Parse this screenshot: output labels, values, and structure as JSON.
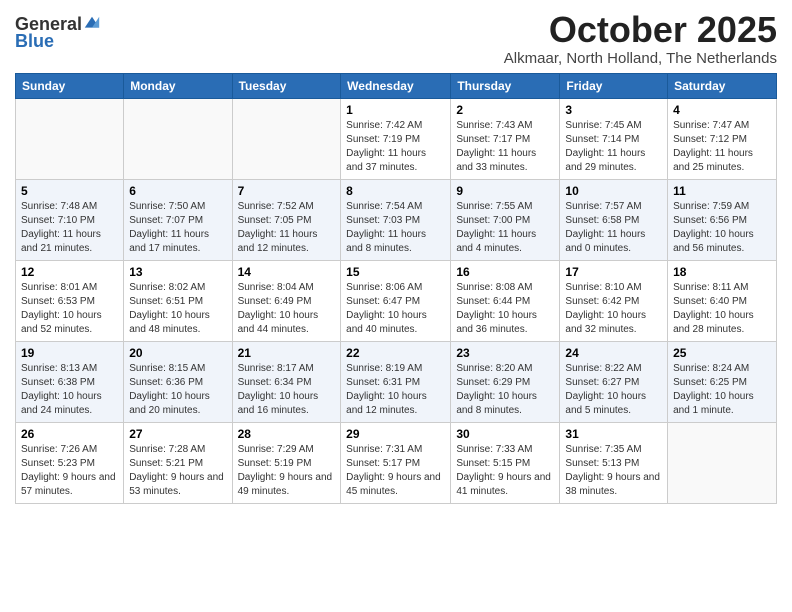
{
  "logo": {
    "general": "General",
    "blue": "Blue"
  },
  "title": "October 2025",
  "subtitle": "Alkmaar, North Holland, The Netherlands",
  "weekdays": [
    "Sunday",
    "Monday",
    "Tuesday",
    "Wednesday",
    "Thursday",
    "Friday",
    "Saturday"
  ],
  "weeks": [
    [
      {
        "day": "",
        "info": ""
      },
      {
        "day": "",
        "info": ""
      },
      {
        "day": "",
        "info": ""
      },
      {
        "day": "1",
        "info": "Sunrise: 7:42 AM\nSunset: 7:19 PM\nDaylight: 11 hours and 37 minutes."
      },
      {
        "day": "2",
        "info": "Sunrise: 7:43 AM\nSunset: 7:17 PM\nDaylight: 11 hours and 33 minutes."
      },
      {
        "day": "3",
        "info": "Sunrise: 7:45 AM\nSunset: 7:14 PM\nDaylight: 11 hours and 29 minutes."
      },
      {
        "day": "4",
        "info": "Sunrise: 7:47 AM\nSunset: 7:12 PM\nDaylight: 11 hours and 25 minutes."
      }
    ],
    [
      {
        "day": "5",
        "info": "Sunrise: 7:48 AM\nSunset: 7:10 PM\nDaylight: 11 hours and 21 minutes."
      },
      {
        "day": "6",
        "info": "Sunrise: 7:50 AM\nSunset: 7:07 PM\nDaylight: 11 hours and 17 minutes."
      },
      {
        "day": "7",
        "info": "Sunrise: 7:52 AM\nSunset: 7:05 PM\nDaylight: 11 hours and 12 minutes."
      },
      {
        "day": "8",
        "info": "Sunrise: 7:54 AM\nSunset: 7:03 PM\nDaylight: 11 hours and 8 minutes."
      },
      {
        "day": "9",
        "info": "Sunrise: 7:55 AM\nSunset: 7:00 PM\nDaylight: 11 hours and 4 minutes."
      },
      {
        "day": "10",
        "info": "Sunrise: 7:57 AM\nSunset: 6:58 PM\nDaylight: 11 hours and 0 minutes."
      },
      {
        "day": "11",
        "info": "Sunrise: 7:59 AM\nSunset: 6:56 PM\nDaylight: 10 hours and 56 minutes."
      }
    ],
    [
      {
        "day": "12",
        "info": "Sunrise: 8:01 AM\nSunset: 6:53 PM\nDaylight: 10 hours and 52 minutes."
      },
      {
        "day": "13",
        "info": "Sunrise: 8:02 AM\nSunset: 6:51 PM\nDaylight: 10 hours and 48 minutes."
      },
      {
        "day": "14",
        "info": "Sunrise: 8:04 AM\nSunset: 6:49 PM\nDaylight: 10 hours and 44 minutes."
      },
      {
        "day": "15",
        "info": "Sunrise: 8:06 AM\nSunset: 6:47 PM\nDaylight: 10 hours and 40 minutes."
      },
      {
        "day": "16",
        "info": "Sunrise: 8:08 AM\nSunset: 6:44 PM\nDaylight: 10 hours and 36 minutes."
      },
      {
        "day": "17",
        "info": "Sunrise: 8:10 AM\nSunset: 6:42 PM\nDaylight: 10 hours and 32 minutes."
      },
      {
        "day": "18",
        "info": "Sunrise: 8:11 AM\nSunset: 6:40 PM\nDaylight: 10 hours and 28 minutes."
      }
    ],
    [
      {
        "day": "19",
        "info": "Sunrise: 8:13 AM\nSunset: 6:38 PM\nDaylight: 10 hours and 24 minutes."
      },
      {
        "day": "20",
        "info": "Sunrise: 8:15 AM\nSunset: 6:36 PM\nDaylight: 10 hours and 20 minutes."
      },
      {
        "day": "21",
        "info": "Sunrise: 8:17 AM\nSunset: 6:34 PM\nDaylight: 10 hours and 16 minutes."
      },
      {
        "day": "22",
        "info": "Sunrise: 8:19 AM\nSunset: 6:31 PM\nDaylight: 10 hours and 12 minutes."
      },
      {
        "day": "23",
        "info": "Sunrise: 8:20 AM\nSunset: 6:29 PM\nDaylight: 10 hours and 8 minutes."
      },
      {
        "day": "24",
        "info": "Sunrise: 8:22 AM\nSunset: 6:27 PM\nDaylight: 10 hours and 5 minutes."
      },
      {
        "day": "25",
        "info": "Sunrise: 8:24 AM\nSunset: 6:25 PM\nDaylight: 10 hours and 1 minute."
      }
    ],
    [
      {
        "day": "26",
        "info": "Sunrise: 7:26 AM\nSunset: 5:23 PM\nDaylight: 9 hours and 57 minutes."
      },
      {
        "day": "27",
        "info": "Sunrise: 7:28 AM\nSunset: 5:21 PM\nDaylight: 9 hours and 53 minutes."
      },
      {
        "day": "28",
        "info": "Sunrise: 7:29 AM\nSunset: 5:19 PM\nDaylight: 9 hours and 49 minutes."
      },
      {
        "day": "29",
        "info": "Sunrise: 7:31 AM\nSunset: 5:17 PM\nDaylight: 9 hours and 45 minutes."
      },
      {
        "day": "30",
        "info": "Sunrise: 7:33 AM\nSunset: 5:15 PM\nDaylight: 9 hours and 41 minutes."
      },
      {
        "day": "31",
        "info": "Sunrise: 7:35 AM\nSunset: 5:13 PM\nDaylight: 9 hours and 38 minutes."
      },
      {
        "day": "",
        "info": ""
      }
    ]
  ]
}
